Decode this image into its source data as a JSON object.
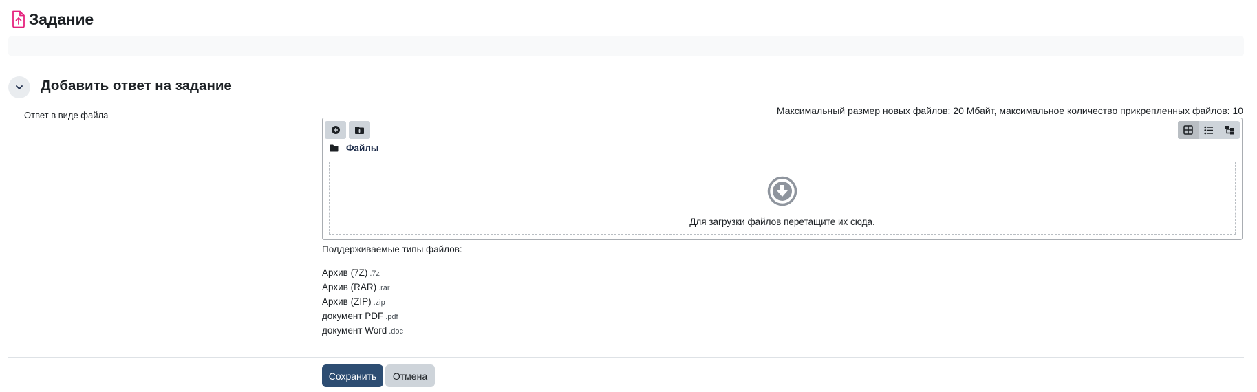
{
  "header": {
    "title": "Задание",
    "icon": "assignment-upload-icon",
    "icon_color": "#e5227d"
  },
  "section": {
    "title": "Добавить ответ на задание",
    "toggle_icon": "chevron-down-icon"
  },
  "form": {
    "field_label": "Ответ в виде файла",
    "limits": "Максимальный размер новых файлов: 20 Мбайт, максимальное количество прикрепленных файлов: 10"
  },
  "filemanager": {
    "toolbar": {
      "add_icon": "add-file-icon",
      "create_folder_icon": "create-folder-icon"
    },
    "views": [
      {
        "icon": "grid-view-icon",
        "active": true
      },
      {
        "icon": "list-view-icon",
        "active": false
      },
      {
        "icon": "tree-view-icon",
        "active": false
      }
    ],
    "path_label": "Файлы",
    "path_icon": "folder-icon",
    "dropzone_text": "Для загрузки файлов перетащите их сюда.",
    "dropzone_icon": "download-circle-icon"
  },
  "file_types": {
    "heading": "Поддерживаемые типы файлов:",
    "items": [
      {
        "name": "Архив (7Z)",
        "ext": ".7z"
      },
      {
        "name": "Архив (RAR)",
        "ext": ".rar"
      },
      {
        "name": "Архив (ZIP)",
        "ext": ".zip"
      },
      {
        "name": "документ PDF",
        "ext": ".pdf"
      },
      {
        "name": "документ Word",
        "ext": ".doc"
      }
    ]
  },
  "actions": {
    "save": "Сохранить",
    "cancel": "Отмена"
  },
  "colors": {
    "primary": "#2d4d72",
    "secondary": "#ced4da",
    "accent": "#e5227d"
  }
}
